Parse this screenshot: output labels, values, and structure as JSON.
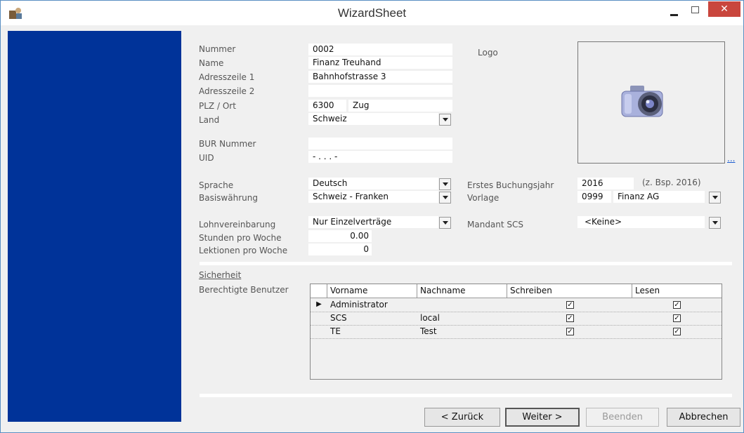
{
  "window": {
    "title": "WizardSheet",
    "close_glyph": "✕"
  },
  "form": {
    "labels": {
      "nummer": "Nummer",
      "name": "Name",
      "adresse1": "Adresszeile 1",
      "adresse2": "Adresszeile 2",
      "plz_ort": "PLZ / Ort",
      "land": "Land",
      "bur": "BUR Nummer",
      "uid": "UID",
      "sprache": "Sprache",
      "waehrung": "Basiswährung",
      "lohn": "Lohnvereinbarung",
      "stunden": "Stunden pro Woche",
      "lektionen": "Lektionen pro Woche",
      "logo": "Logo",
      "buchungsjahr": "Erstes Buchungsjahr",
      "vorlage": "Vorlage",
      "mandant": "Mandant SCS"
    },
    "values": {
      "nummer": "0002",
      "name": "Finanz Treuhand",
      "adresse1": "Bahnhofstrasse 3",
      "adresse2": "",
      "plz": "6300",
      "ort": "Zug",
      "land": "Schweiz",
      "bur": "",
      "uid": "-   .   .   .   -",
      "sprache": "Deutsch",
      "waehrung": "Schweiz - Franken",
      "lohn": "Nur Einzelverträge",
      "stunden": "0.00",
      "lektionen": "0",
      "buchungsjahr": "2016",
      "buchungsjahr_hint": "(z. Bsp. 2016)",
      "vorlage_nr": "0999",
      "vorlage_name": "Finanz AG",
      "mandant": "<Keine>"
    },
    "logo_browse": "..."
  },
  "security": {
    "title": "Sicherheit",
    "users_label": "Berechtigte Benutzer",
    "columns": [
      "Vorname",
      "Nachname",
      "Schreiben",
      "Lesen"
    ],
    "rows": [
      {
        "vorname": "Administrator",
        "nachname": "",
        "schreiben": true,
        "lesen": true,
        "current": true
      },
      {
        "vorname": "SCS",
        "nachname": "local",
        "schreiben": true,
        "lesen": true,
        "current": false
      },
      {
        "vorname": "TE",
        "nachname": "Test",
        "schreiben": true,
        "lesen": true,
        "current": false
      }
    ]
  },
  "buttons": {
    "back": "< Zurück",
    "next": "Weiter >",
    "finish": "Beenden",
    "cancel": "Abbrechen"
  },
  "colors": {
    "sidebar": "#003399",
    "close_button": "#c9463d"
  }
}
